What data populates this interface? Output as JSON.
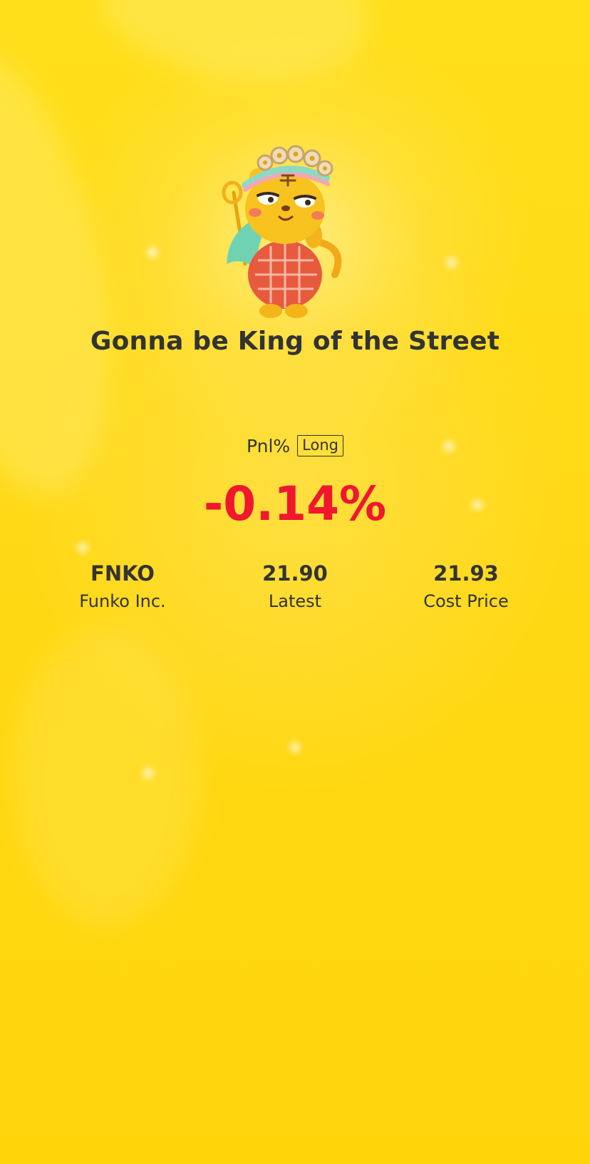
{
  "card": {
    "headline": "Gonna be King of the Street",
    "mascot_icon": "tiger-king-mascot-icon"
  },
  "pnl": {
    "label": "Pnl%",
    "direction": "Long",
    "value": "-0.14%",
    "value_color": "#F0172F"
  },
  "stats": [
    {
      "value": "FNKO",
      "label": "Funko Inc."
    },
    {
      "value": "21.90",
      "label": "Latest"
    },
    {
      "value": "21.93",
      "label": "Cost Price"
    }
  ],
  "colors": {
    "background": "#FFD815",
    "text": "#333333"
  }
}
